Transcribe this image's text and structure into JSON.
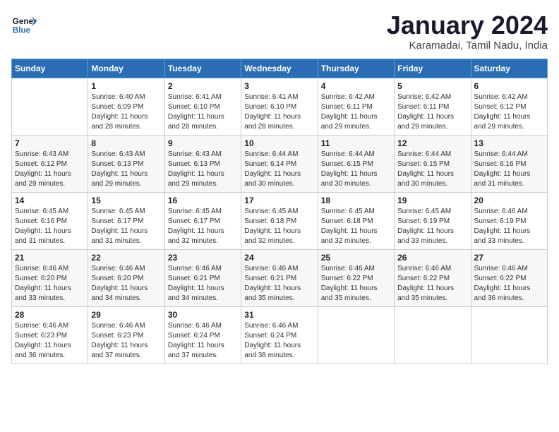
{
  "header": {
    "logo_line1": "General",
    "logo_line2": "Blue",
    "month": "January 2024",
    "location": "Karamadai, Tamil Nadu, India"
  },
  "days_of_week": [
    "Sunday",
    "Monday",
    "Tuesday",
    "Wednesday",
    "Thursday",
    "Friday",
    "Saturday"
  ],
  "weeks": [
    [
      {
        "day": "",
        "detail": ""
      },
      {
        "day": "1",
        "detail": "Sunrise: 6:40 AM\nSunset: 6:09 PM\nDaylight: 11 hours\nand 28 minutes."
      },
      {
        "day": "2",
        "detail": "Sunrise: 6:41 AM\nSunset: 6:10 PM\nDaylight: 11 hours\nand 28 minutes."
      },
      {
        "day": "3",
        "detail": "Sunrise: 6:41 AM\nSunset: 6:10 PM\nDaylight: 11 hours\nand 28 minutes."
      },
      {
        "day": "4",
        "detail": "Sunrise: 6:42 AM\nSunset: 6:11 PM\nDaylight: 11 hours\nand 29 minutes."
      },
      {
        "day": "5",
        "detail": "Sunrise: 6:42 AM\nSunset: 6:11 PM\nDaylight: 11 hours\nand 29 minutes."
      },
      {
        "day": "6",
        "detail": "Sunrise: 6:42 AM\nSunset: 6:12 PM\nDaylight: 11 hours\nand 29 minutes."
      }
    ],
    [
      {
        "day": "7",
        "detail": "Sunrise: 6:43 AM\nSunset: 6:12 PM\nDaylight: 11 hours\nand 29 minutes."
      },
      {
        "day": "8",
        "detail": "Sunrise: 6:43 AM\nSunset: 6:13 PM\nDaylight: 11 hours\nand 29 minutes."
      },
      {
        "day": "9",
        "detail": "Sunrise: 6:43 AM\nSunset: 6:13 PM\nDaylight: 11 hours\nand 29 minutes."
      },
      {
        "day": "10",
        "detail": "Sunrise: 6:44 AM\nSunset: 6:14 PM\nDaylight: 11 hours\nand 30 minutes."
      },
      {
        "day": "11",
        "detail": "Sunrise: 6:44 AM\nSunset: 6:15 PM\nDaylight: 11 hours\nand 30 minutes."
      },
      {
        "day": "12",
        "detail": "Sunrise: 6:44 AM\nSunset: 6:15 PM\nDaylight: 11 hours\nand 30 minutes."
      },
      {
        "day": "13",
        "detail": "Sunrise: 6:44 AM\nSunset: 6:16 PM\nDaylight: 11 hours\nand 31 minutes."
      }
    ],
    [
      {
        "day": "14",
        "detail": "Sunrise: 6:45 AM\nSunset: 6:16 PM\nDaylight: 11 hours\nand 31 minutes."
      },
      {
        "day": "15",
        "detail": "Sunrise: 6:45 AM\nSunset: 6:17 PM\nDaylight: 11 hours\nand 31 minutes."
      },
      {
        "day": "16",
        "detail": "Sunrise: 6:45 AM\nSunset: 6:17 PM\nDaylight: 11 hours\nand 32 minutes."
      },
      {
        "day": "17",
        "detail": "Sunrise: 6:45 AM\nSunset: 6:18 PM\nDaylight: 11 hours\nand 32 minutes."
      },
      {
        "day": "18",
        "detail": "Sunrise: 6:45 AM\nSunset: 6:18 PM\nDaylight: 11 hours\nand 32 minutes."
      },
      {
        "day": "19",
        "detail": "Sunrise: 6:45 AM\nSunset: 6:19 PM\nDaylight: 11 hours\nand 33 minutes."
      },
      {
        "day": "20",
        "detail": "Sunrise: 6:46 AM\nSunset: 6:19 PM\nDaylight: 11 hours\nand 33 minutes."
      }
    ],
    [
      {
        "day": "21",
        "detail": "Sunrise: 6:46 AM\nSunset: 6:20 PM\nDaylight: 11 hours\nand 33 minutes."
      },
      {
        "day": "22",
        "detail": "Sunrise: 6:46 AM\nSunset: 6:20 PM\nDaylight: 11 hours\nand 34 minutes."
      },
      {
        "day": "23",
        "detail": "Sunrise: 6:46 AM\nSunset: 6:21 PM\nDaylight: 11 hours\nand 34 minutes."
      },
      {
        "day": "24",
        "detail": "Sunrise: 6:46 AM\nSunset: 6:21 PM\nDaylight: 11 hours\nand 35 minutes."
      },
      {
        "day": "25",
        "detail": "Sunrise: 6:46 AM\nSunset: 6:22 PM\nDaylight: 11 hours\nand 35 minutes."
      },
      {
        "day": "26",
        "detail": "Sunrise: 6:46 AM\nSunset: 6:22 PM\nDaylight: 11 hours\nand 35 minutes."
      },
      {
        "day": "27",
        "detail": "Sunrise: 6:46 AM\nSunset: 6:22 PM\nDaylight: 11 hours\nand 36 minutes."
      }
    ],
    [
      {
        "day": "28",
        "detail": "Sunrise: 6:46 AM\nSunset: 6:23 PM\nDaylight: 11 hours\nand 36 minutes."
      },
      {
        "day": "29",
        "detail": "Sunrise: 6:46 AM\nSunset: 6:23 PM\nDaylight: 11 hours\nand 37 minutes."
      },
      {
        "day": "30",
        "detail": "Sunrise: 6:46 AM\nSunset: 6:24 PM\nDaylight: 11 hours\nand 37 minutes."
      },
      {
        "day": "31",
        "detail": "Sunrise: 6:46 AM\nSunset: 6:24 PM\nDaylight: 11 hours\nand 38 minutes."
      },
      {
        "day": "",
        "detail": ""
      },
      {
        "day": "",
        "detail": ""
      },
      {
        "day": "",
        "detail": ""
      }
    ]
  ]
}
